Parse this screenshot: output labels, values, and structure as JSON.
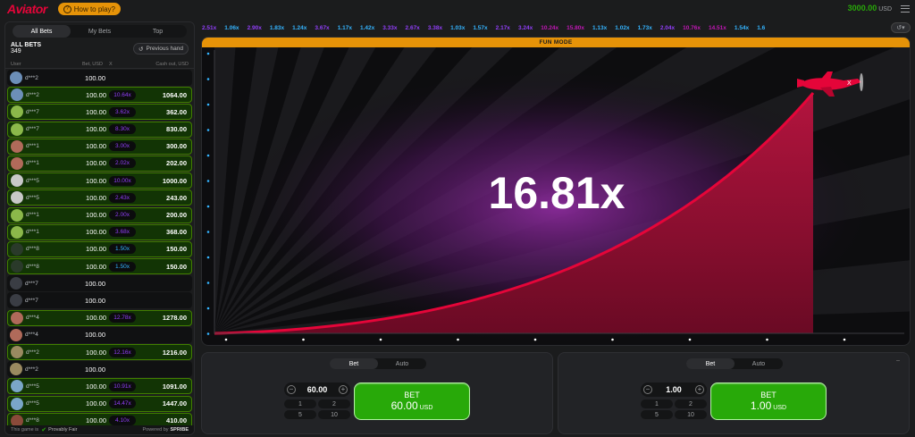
{
  "header": {
    "logo": "Aviator",
    "how_to_play": "How to play?",
    "balance": "3000.00",
    "currency": "USD"
  },
  "bets_panel": {
    "tabs": [
      "All Bets",
      "My Bets",
      "Top"
    ],
    "active_tab": "All Bets",
    "title": "ALL BETS",
    "count": "349",
    "previous_hand": "Previous hand",
    "columns": {
      "user": "User",
      "bet": "Bet, USD",
      "x": "X",
      "cashout": "Cash out, USD"
    },
    "rows": [
      {
        "user": "d***2",
        "bet": "100.00",
        "mult": "",
        "cash": "",
        "win": false,
        "avatar": "#6c8fb8"
      },
      {
        "user": "d***2",
        "bet": "100.00",
        "mult": "10.64x",
        "cash": "1064.00",
        "win": true,
        "avatar": "#6c8fb8",
        "mc": "purple"
      },
      {
        "user": "d***7",
        "bet": "100.00",
        "mult": "3.62x",
        "cash": "362.00",
        "win": true,
        "avatar": "#8bb84a",
        "mc": "purple"
      },
      {
        "user": "d***7",
        "bet": "100.00",
        "mult": "8.30x",
        "cash": "830.00",
        "win": true,
        "avatar": "#8bb84a",
        "mc": "purple"
      },
      {
        "user": "d***1",
        "bet": "100.00",
        "mult": "3.00x",
        "cash": "300.00",
        "win": true,
        "avatar": "#b06a5a",
        "mc": "purple"
      },
      {
        "user": "d***1",
        "bet": "100.00",
        "mult": "2.02x",
        "cash": "202.00",
        "win": true,
        "avatar": "#b06a5a",
        "mc": "purple"
      },
      {
        "user": "d***5",
        "bet": "100.00",
        "mult": "10.00x",
        "cash": "1000.00",
        "win": true,
        "avatar": "#c8c8c8",
        "mc": "purple"
      },
      {
        "user": "d***5",
        "bet": "100.00",
        "mult": "2.43x",
        "cash": "243.00",
        "win": true,
        "avatar": "#c8c8c8",
        "mc": "purple"
      },
      {
        "user": "d***1",
        "bet": "100.00",
        "mult": "2.00x",
        "cash": "200.00",
        "win": true,
        "avatar": "#8bb84a",
        "mc": "purple"
      },
      {
        "user": "d***1",
        "bet": "100.00",
        "mult": "3.68x",
        "cash": "368.00",
        "win": true,
        "avatar": "#8bb84a",
        "mc": "purple"
      },
      {
        "user": "d***8",
        "bet": "100.00",
        "mult": "1.50x",
        "cash": "150.00",
        "win": true,
        "avatar": "#2a3a2a",
        "mc": "blue"
      },
      {
        "user": "d***8",
        "bet": "100.00",
        "mult": "1.50x",
        "cash": "150.00",
        "win": true,
        "avatar": "#2a3a2a",
        "mc": "blue"
      },
      {
        "user": "d***7",
        "bet": "100.00",
        "mult": "",
        "cash": "",
        "win": false,
        "avatar": "#3a3d44"
      },
      {
        "user": "d***7",
        "bet": "100.00",
        "mult": "",
        "cash": "",
        "win": false,
        "avatar": "#3a3d44"
      },
      {
        "user": "d***4",
        "bet": "100.00",
        "mult": "12.78x",
        "cash": "1278.00",
        "win": true,
        "avatar": "#b06a5a",
        "mc": "purple"
      },
      {
        "user": "d***4",
        "bet": "100.00",
        "mult": "",
        "cash": "",
        "win": false,
        "avatar": "#b06a5a"
      },
      {
        "user": "d***2",
        "bet": "100.00",
        "mult": "12.16x",
        "cash": "1216.00",
        "win": true,
        "avatar": "#9a8a60",
        "mc": "purple"
      },
      {
        "user": "d***2",
        "bet": "100.00",
        "mult": "",
        "cash": "",
        "win": false,
        "avatar": "#9a8a60"
      },
      {
        "user": "d***5",
        "bet": "100.00",
        "mult": "10.91x",
        "cash": "1091.00",
        "win": true,
        "avatar": "#7aa6c8",
        "mc": "purple"
      },
      {
        "user": "d***5",
        "bet": "100.00",
        "mult": "14.47x",
        "cash": "1447.00",
        "win": true,
        "avatar": "#7aa6c8",
        "mc": "purple"
      },
      {
        "user": "d***8",
        "bet": "100.00",
        "mult": "4.10x",
        "cash": "410.00",
        "win": true,
        "avatar": "#8a4a3a",
        "mc": "purple"
      }
    ],
    "footer": {
      "this_game_is": "This game is",
      "provably_fair": "Provably Fair",
      "powered_by": "Powered by",
      "provider": "SPRIBE"
    }
  },
  "history": [
    {
      "v": "2.51x",
      "c": "purple"
    },
    {
      "v": "1.06x",
      "c": "blue"
    },
    {
      "v": "2.90x",
      "c": "purple"
    },
    {
      "v": "1.83x",
      "c": "blue"
    },
    {
      "v": "1.24x",
      "c": "blue"
    },
    {
      "v": "3.67x",
      "c": "purple"
    },
    {
      "v": "1.17x",
      "c": "blue"
    },
    {
      "v": "1.42x",
      "c": "blue"
    },
    {
      "v": "3.33x",
      "c": "purple"
    },
    {
      "v": "2.67x",
      "c": "purple"
    },
    {
      "v": "3.38x",
      "c": "purple"
    },
    {
      "v": "1.03x",
      "c": "blue"
    },
    {
      "v": "1.57x",
      "c": "blue"
    },
    {
      "v": "2.17x",
      "c": "purple"
    },
    {
      "v": "3.24x",
      "c": "purple"
    },
    {
      "v": "10.24x",
      "c": "pink"
    },
    {
      "v": "15.80x",
      "c": "pink"
    },
    {
      "v": "1.13x",
      "c": "blue"
    },
    {
      "v": "1.02x",
      "c": "blue"
    },
    {
      "v": "1.73x",
      "c": "blue"
    },
    {
      "v": "2.04x",
      "c": "purple"
    },
    {
      "v": "10.76x",
      "c": "pink"
    },
    {
      "v": "14.51x",
      "c": "pink"
    },
    {
      "v": "1.54x",
      "c": "blue"
    },
    {
      "v": "1.6",
      "c": "blue"
    }
  ],
  "game": {
    "mode_label": "FUN MODE",
    "multiplier": "16.81x"
  },
  "bet_panels": [
    {
      "tabs": [
        "Bet",
        "Auto"
      ],
      "amount": "60.00",
      "quick": [
        "1",
        "2",
        "5",
        "10"
      ],
      "button_label": "BET",
      "button_amount": "60.00",
      "currency": "USD"
    },
    {
      "tabs": [
        "Bet",
        "Auto"
      ],
      "amount": "1.00",
      "quick": [
        "1",
        "2",
        "5",
        "10"
      ],
      "button_label": "BET",
      "button_amount": "1.00",
      "currency": "USD"
    }
  ],
  "colors": {
    "brand": "#e50539",
    "accent": "#e69308",
    "win": "#28a909",
    "blue": "#34b4ff",
    "purple": "#913ef8",
    "pink": "#c017b4"
  }
}
